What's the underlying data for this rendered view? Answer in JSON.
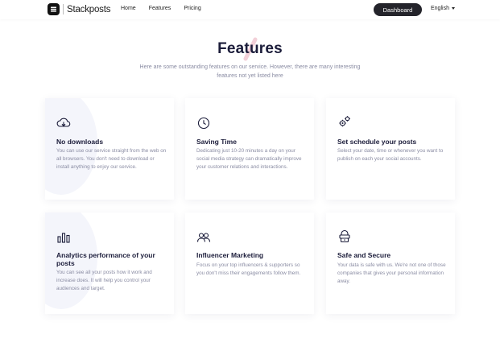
{
  "header": {
    "brand": "Stackposts",
    "nav": [
      "Home",
      "Features",
      "Pricing"
    ],
    "dashboard_label": "Dashboard",
    "language": "English"
  },
  "hero": {
    "title": "Features",
    "subtitle": "Here are some outstanding features on our service. However, there are many interesting features not yet listed here"
  },
  "features": [
    {
      "icon": "download-cloud-icon",
      "title": "No downloads",
      "text": "You can use our service straight from the web on all browsers. You don't need to download or install anything to enjoy our service."
    },
    {
      "icon": "clock-icon",
      "title": "Saving Time",
      "text": "Dedicating just 10-20 minutes a day on your social media strategy can dramatically improve your customer relations and interactions."
    },
    {
      "icon": "gears-icon",
      "title": "Set schedule your posts",
      "text": "Select your date, time or whenever you want to publish on each your social accounts."
    },
    {
      "icon": "bar-chart-icon",
      "title": "Analytics performance of your posts",
      "text": "You can see all your posts how it work and increase does. It will help you control your audiences and target."
    },
    {
      "icon": "users-icon",
      "title": "Influencer Marketing",
      "text": "Focus on your top influencers & supporters so you don't miss their engagements follow them."
    },
    {
      "icon": "secure-lock-icon",
      "title": "Safe and Secure",
      "text": "Your data is safe with us. We're not one of those companies that gives your personal information away."
    }
  ]
}
